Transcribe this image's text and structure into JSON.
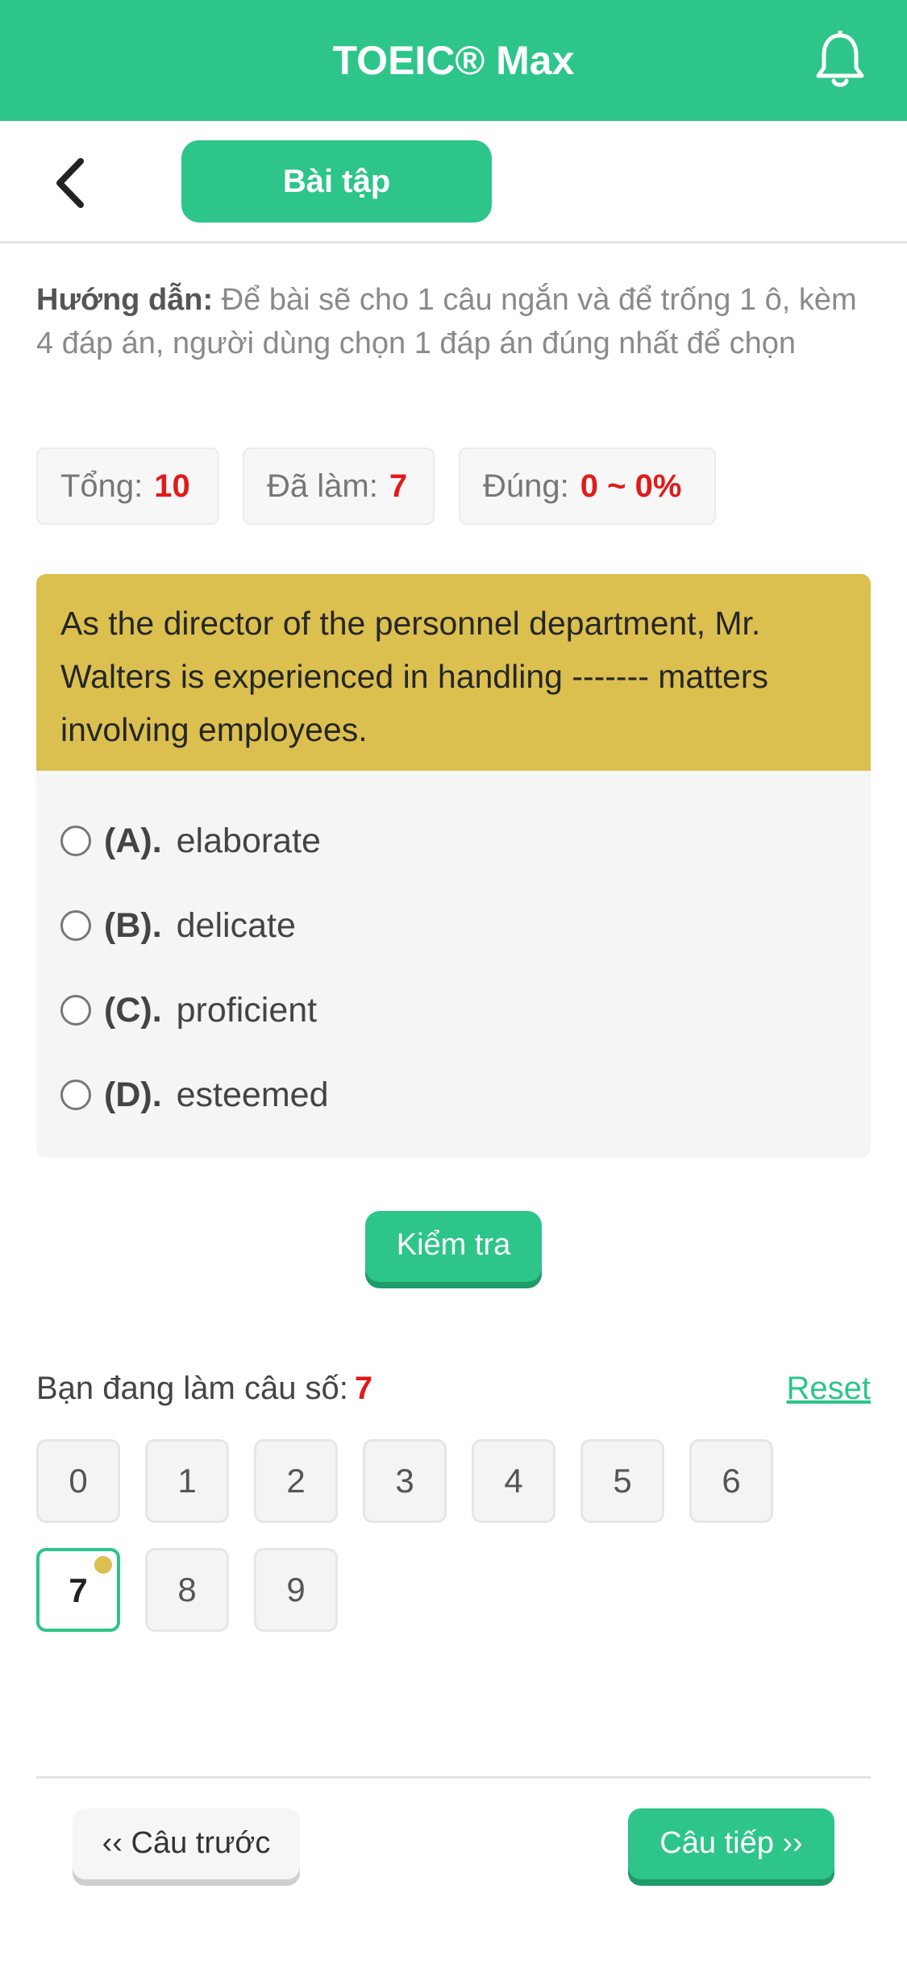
{
  "header": {
    "title": "TOEIC® Max",
    "bell_icon": "bell-icon"
  },
  "nav": {
    "back_icon": "chevron-left-icon",
    "tab_label": "Bài tập"
  },
  "guide": {
    "label": "Hướng dẫn:",
    "text": "Để bài sẽ cho 1 câu ngắn và để trống 1 ô, kèm 4 đáp án, người dùng chọn 1 đáp án đúng nhất để chọn"
  },
  "stats": [
    {
      "label": "Tổng:",
      "value": "10"
    },
    {
      "label": "Đã làm:",
      "value": "7"
    },
    {
      "label": "Đúng:",
      "value": "0 ~ 0%"
    }
  ],
  "question": {
    "text": "As the director of the personnel department, Mr. Walters is experienced in handling ------- matters involving employees."
  },
  "options": [
    {
      "label": "(A).",
      "text": "elaborate"
    },
    {
      "label": "(B).",
      "text": "delicate"
    },
    {
      "label": "(C).",
      "text": "proficient"
    },
    {
      "label": "(D).",
      "text": "esteemed"
    }
  ],
  "check_label": "Kiểm tra",
  "progress": {
    "label": "Bạn đang làm câu số:",
    "current": "7",
    "reset_label": "Reset"
  },
  "question_numbers": [
    "0",
    "1",
    "2",
    "3",
    "4",
    "5",
    "6",
    "7",
    "8",
    "9"
  ],
  "footer": {
    "prev_label": "‹‹ Câu trước",
    "next_label": "Câu tiếp ››"
  },
  "colors": {
    "brand": "#2dc589",
    "question_bg": "#dbc050",
    "highlight": "#e11a1a"
  }
}
